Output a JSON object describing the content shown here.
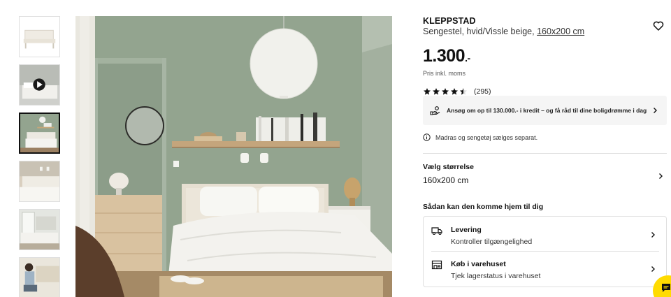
{
  "product": {
    "name": "KLEPPSTAD",
    "description": "Sengestel, hvid/Vissle beige,",
    "size_link": "160x200 cm",
    "price_main": "1.300",
    "price_suffix": ".-",
    "price_note": "Pris inkl. moms",
    "rating": 4.5,
    "rating_count": "(295)"
  },
  "credit_banner": {
    "text": "Ansøg om op til 130.000.- i kredit – og få råd til dine boligdrømme i dag"
  },
  "notice": {
    "text": "Madras og sengetøj sælges separat."
  },
  "size_selector": {
    "label": "Vælg størrelse",
    "value": "160x200 cm"
  },
  "delivery": {
    "title": "Sådan kan den komme hjem til dig",
    "options": [
      {
        "title": "Levering",
        "subtitle": "Kontroller tilgængelighed",
        "icon": "truck-icon"
      },
      {
        "title": "Køb i varehuset",
        "subtitle": "Tjek lagerstatus i varehuset",
        "icon": "store-icon"
      }
    ]
  },
  "thumbnails": [
    {
      "name": "bed-frame-product",
      "active": false
    },
    {
      "name": "video",
      "active": false,
      "has_play": true
    },
    {
      "name": "bedroom-green",
      "active": true
    },
    {
      "name": "headboard-closeup",
      "active": false
    },
    {
      "name": "bedroom-window",
      "active": false
    },
    {
      "name": "person-assembling",
      "active": false
    }
  ],
  "colors": {
    "wall_green": "#93a48f",
    "chat_yellow": "#ffdb00",
    "panel_grey": "#f5f5f5"
  }
}
